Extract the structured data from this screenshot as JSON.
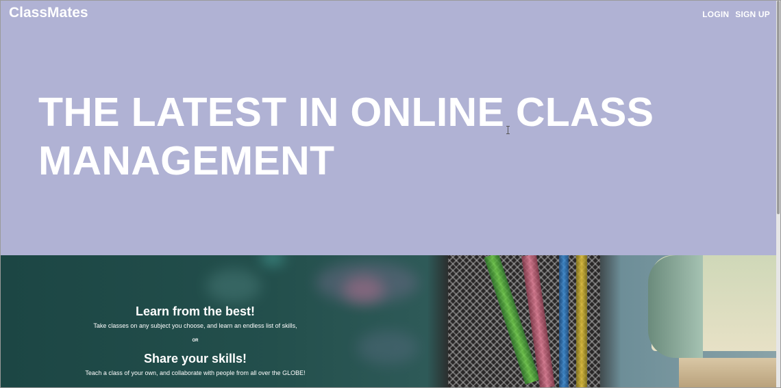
{
  "header": {
    "brand": "ClassMates",
    "nav": {
      "login_label": "LOGIN",
      "signup_label": "SIGN UP"
    }
  },
  "hero": {
    "headline_line1": "THE LATEST IN ONLINE CLASS",
    "headline_line2": "MANAGEMENT",
    "background_color": "#b0b2d4"
  },
  "feature": {
    "learn_title": "Learn from the best!",
    "learn_text": "Take classes on any subject you choose, and learn an endless list of skills,",
    "or_label": "OR",
    "share_title": "Share your skills!",
    "share_text": "Teach a class of your own, and collaborate with people from all over the GLOBE!"
  },
  "icons": {
    "cursor": "text-cursor-icon"
  }
}
